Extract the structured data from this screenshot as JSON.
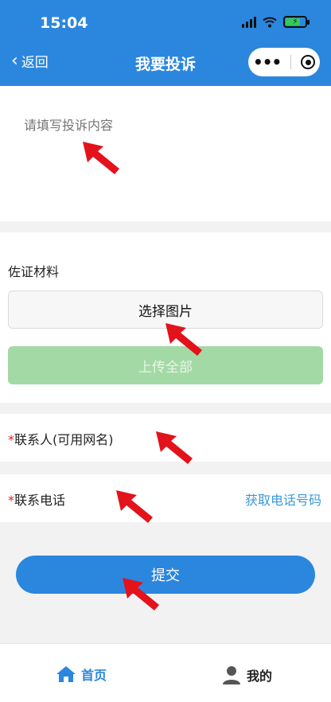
{
  "status_bar": {
    "time": "15:04"
  },
  "nav": {
    "back_label": "返回",
    "title": "我要投诉"
  },
  "content": {
    "placeholder": "请填写投诉内容"
  },
  "evidence": {
    "title": "佐证材料",
    "choose_label": "选择图片",
    "upload_label": "上传全部"
  },
  "contact": {
    "required_mark": "*",
    "label": "联系人(可用网名)"
  },
  "phone": {
    "required_mark": "*",
    "label": "联系电话",
    "get_phone_label": "获取电话号码"
  },
  "submit": {
    "label": "提交"
  },
  "tabbar": {
    "home_label": "首页",
    "mine_label": "我的"
  },
  "colors": {
    "header": "#2b86de",
    "upload_button": "#a3d9a5",
    "link": "#3a9ad9",
    "arrow": "#e3121b",
    "required": "#e02020"
  },
  "icons": [
    "back-chevron-icon",
    "more-dots-icon",
    "target-icon",
    "signal-icon",
    "wifi-icon",
    "battery-icon",
    "home-icon",
    "user-icon",
    "red-arrow-icon"
  ]
}
